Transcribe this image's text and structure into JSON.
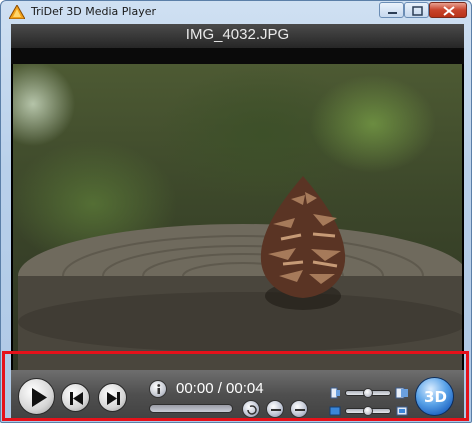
{
  "window": {
    "title": "TriDef 3D Media Player"
  },
  "player": {
    "filename": "IMG_4032.JPG",
    "time_display": "00:00 / 00:04"
  },
  "controls": {
    "button_3d": "3D"
  },
  "colors": {
    "highlight": "#e5111a",
    "control_bar": "#4f4f4f",
    "button_3d": "#1f64c2"
  },
  "icons": {
    "play": "play-icon",
    "prev": "skip-back-icon",
    "next": "skip-forward-icon",
    "info": "info-icon",
    "reset": "reset-view-icon",
    "fit": "fit-icon",
    "zoom": "zoom-icon"
  }
}
